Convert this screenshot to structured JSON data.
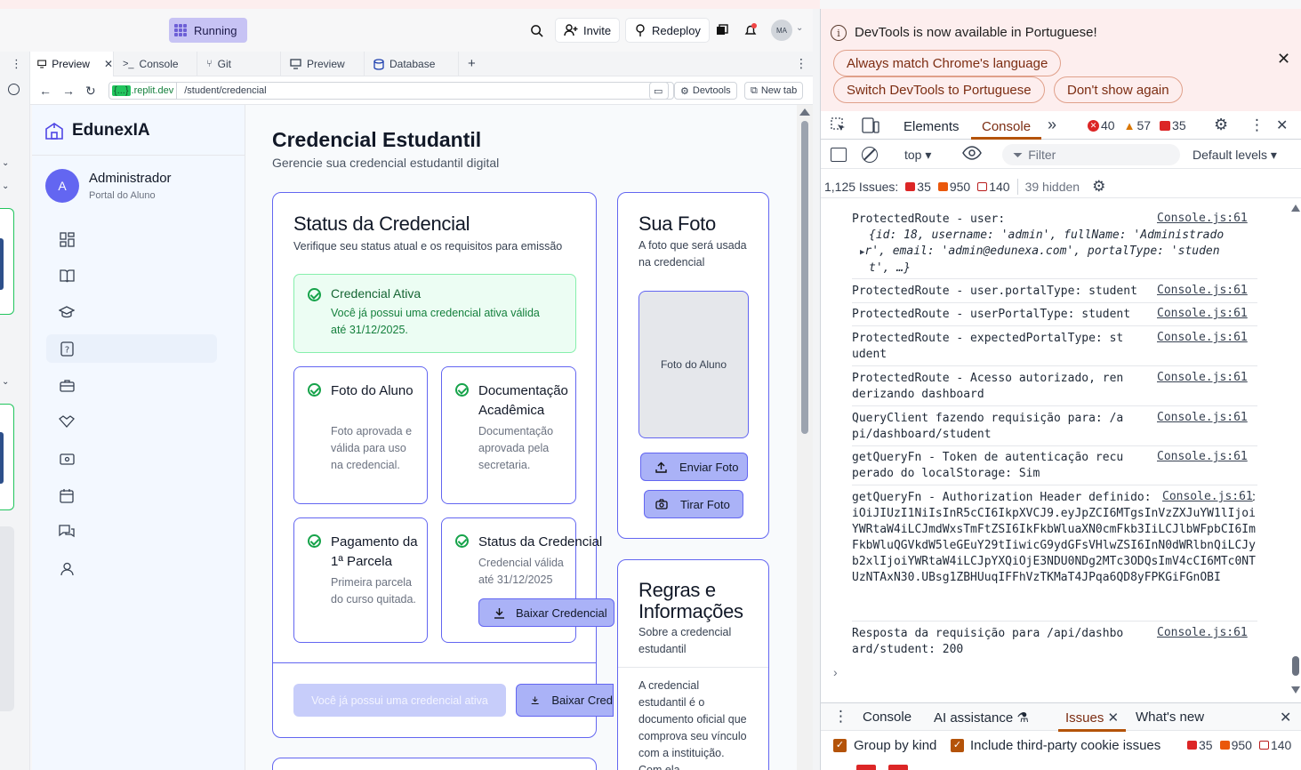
{
  "replit": {
    "status": "Running",
    "invite": "Invite",
    "redeploy": "Redeploy",
    "avatar_initials": "MA",
    "tabs": [
      "Preview",
      "Console",
      "Git",
      "Preview",
      "Database"
    ],
    "url_domain_badge": "{...}",
    "url_domain": ".replit.dev",
    "url_path": "/student/credencial",
    "devtools_btn": "Devtools",
    "newtab_btn": "New tab"
  },
  "app": {
    "brand": "EdunexIA",
    "user_initial": "A",
    "user_name": "Administrador",
    "user_role": "Portal do Aluno",
    "page_title": "Credencial Estudantil",
    "page_subtitle": "Gerencie sua credencial estudantil digital",
    "status_card": {
      "title": "Status da Credencial",
      "subtitle": "Verifique seu status atual e os requisitos para emissão",
      "active_title": "Credencial Ativa",
      "active_desc": "Você já possui uma credencial ativa válida até 31/12/2025.",
      "items": [
        {
          "title": "Foto do Aluno",
          "desc": "Foto aprovada e válida para uso na credencial."
        },
        {
          "title": "Documentação Acadêmica",
          "desc": "Documentação aprovada pela secretaria."
        },
        {
          "title": "Pagamento da 1ª Parcela",
          "desc": "Primeira parcela do curso quitada."
        },
        {
          "title": "Status da Credencial",
          "desc": "Credencial válida até 31/12/2025"
        }
      ],
      "download_btn": "Baixar Credencial",
      "disabled_btn": "Você já possui uma credencial ativa",
      "download_btn_2": "Baixar Cred"
    },
    "photo_card": {
      "title": "Sua Foto",
      "subtitle": "A foto que será usada na credencial",
      "placeholder": "Foto do Aluno",
      "send_btn": "Enviar Foto",
      "take_btn": "Tirar Foto"
    },
    "rules_card": {
      "title": "Regras e Informações",
      "subtitle": "Sobre a credencial estudantil",
      "body": "A credencial estudantil é o documento oficial que comprova seu vínculo com a instituição. Com ela"
    }
  },
  "devtools": {
    "infobar_text": "DevTools is now available in Portuguese!",
    "btn_match": "Always match Chrome's language",
    "btn_switch": "Switch DevTools to Portuguese",
    "btn_dont": "Don't show again",
    "tabs": {
      "elements": "Elements",
      "console": "Console"
    },
    "counts": {
      "errors": "40",
      "warnings": "57",
      "issues": "35"
    },
    "context": "top",
    "filter_placeholder": "Filter",
    "levels": "Default levels",
    "issues_label": "1,125 Issues:",
    "issues_counts": {
      "red": "35",
      "orange": "950",
      "msg": "140"
    },
    "hidden": "39 hidden",
    "source": "Console.js:61",
    "logs": [
      "ProtectedRoute - user:",
      "ProtectedRoute - user.portalType: student",
      "ProtectedRoute - userPortalType: student",
      "ProtectedRoute - expectedPortalType: student",
      "ProtectedRoute - Acesso autorizado, renderizando dashboard",
      "QueryClient fazendo requisição para: /api/dashboard/student",
      "getQueryFn - Token de autenticação recuperado do localStorage: Sim",
      "getQueryFn - Authorization Header definido: Bearer eyJhbGciOiJIUzI1NiIsInR5cCI6IkpXVCJ9.eyJpZCI6MTgsInVzZXJuYW1lIjoiYWRtaW4iLCJmdWxsTmFtZSI6IkFkbWluaXN0cmFkb3IiLCJlbWFpbCI6ImFkbWluQGVkdW5leGEuY29tIiwicG9ydGFsVHlwZSI6InN0dWRlbnQiLCJyb2xlIjoiYWRtaW4iLCJpYXQiOjE3NDU0NDg2MTc3ODQsImV4cCI6MTc0NTUzNTAxN30.UBsg1ZBHUuqIFFhVzTKMaT4JPqa6QD8yFPKGiFGnOBI",
      "Resposta da requisição para /api/dashboard/student: 200"
    ],
    "user_obj": {
      "line1": "{id: 18, username: 'admin', fullName: 'Administrado",
      "line2": "r', email: 'admin@edunexa.com', portalType: 'studen",
      "line3": "t', …}"
    },
    "drawer": {
      "console": "Console",
      "ai": "AI assistance",
      "issues": "Issues",
      "whatsnew": "What's new"
    },
    "group_by_kind": "Group by kind",
    "third_party": "Include third-party cookie issues",
    "bottom_counts": {
      "red": "35",
      "orange": "950",
      "msg": "140"
    }
  }
}
